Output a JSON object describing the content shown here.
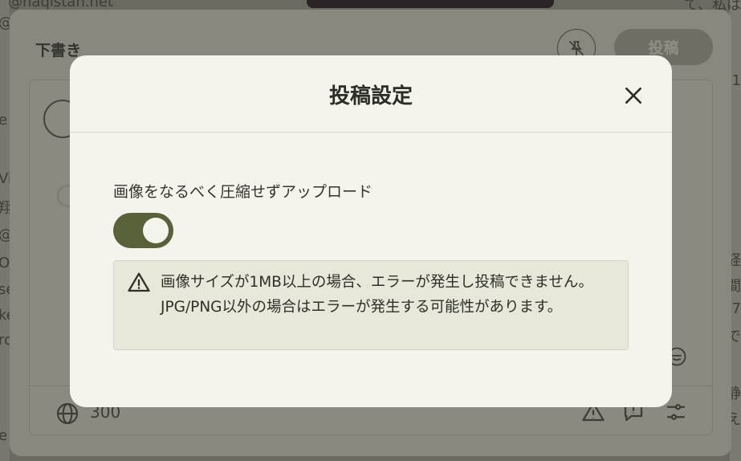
{
  "background": {
    "handle": "@naqistan.net",
    "left_fragments": [
      "@",
      "e",
      "Vi",
      "翔",
      "@",
      "OI",
      "se",
      "ke",
      "ro",
      "e"
    ],
    "right_fragments": [
      "て、私は",
      "1",
      "：",
      "経",
      "間",
      "7",
      "で",
      "静",
      "え"
    ]
  },
  "composer": {
    "title": "下書き",
    "post_button": "投稿",
    "char_count": "300"
  },
  "modal": {
    "title": "投稿設定",
    "option_label": "画像をなるべく圧縮せずアップロード",
    "toggle_on": true,
    "notice": "画像サイズが1MB以上の場合、エラーが発生し投稿できません。JPG/PNG以外の場合はエラーが発生する可能性があります。"
  },
  "colors": {
    "modal_bg": "#f4f4ec",
    "toggle_on": "#596139",
    "notice_bg": "#e7e8d9",
    "overlay": "#6a6a61"
  }
}
